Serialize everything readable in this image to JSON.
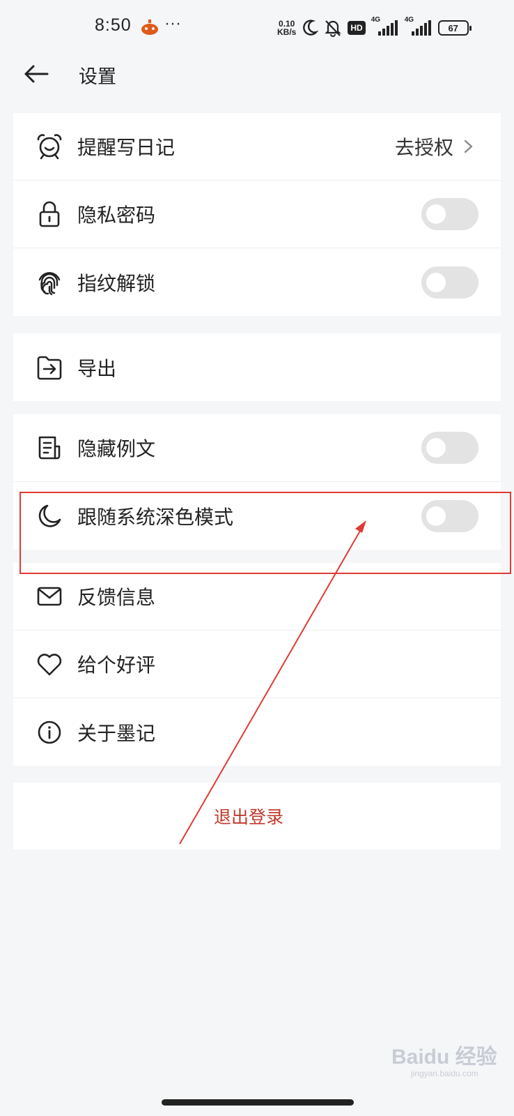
{
  "status_bar": {
    "time": "8:50",
    "more": "···",
    "net_speed_value": "0.10",
    "net_speed_unit": "KB/s",
    "hd_label": "HD",
    "signal_1_label": "4G",
    "signal_2_label": "4G",
    "battery": "67"
  },
  "header": {
    "back_icon": "arrow-left-icon",
    "title": "设置"
  },
  "group1": {
    "items": [
      {
        "icon": "alarm-clock-icon",
        "label": "提醒写日记",
        "action": "去授权"
      },
      {
        "icon": "lock-icon",
        "label": "隐私密码",
        "toggle": false
      },
      {
        "icon": "fingerprint-icon",
        "label": "指纹解锁",
        "toggle": false
      }
    ]
  },
  "group2": {
    "items": [
      {
        "icon": "folder-export-icon",
        "label": "导出"
      }
    ]
  },
  "group3": {
    "items": [
      {
        "icon": "document-icon",
        "label": "隐藏例文",
        "toggle": false
      },
      {
        "icon": "moon-icon",
        "label": "跟随系统深色模式",
        "toggle": false
      }
    ]
  },
  "group4": {
    "items": [
      {
        "icon": "mail-icon",
        "label": "反馈信息"
      },
      {
        "icon": "heart-icon",
        "label": "给个好评"
      },
      {
        "icon": "info-icon",
        "label": "关于墨记"
      }
    ]
  },
  "logout_label": "退出登录",
  "watermark": {
    "text": "Baidu 经验",
    "sub": "jingyan.baidu.com"
  },
  "colors": {
    "annotation": "#e03a33",
    "logout": "#c0392b",
    "toggle_off": "#e3e3e3"
  }
}
